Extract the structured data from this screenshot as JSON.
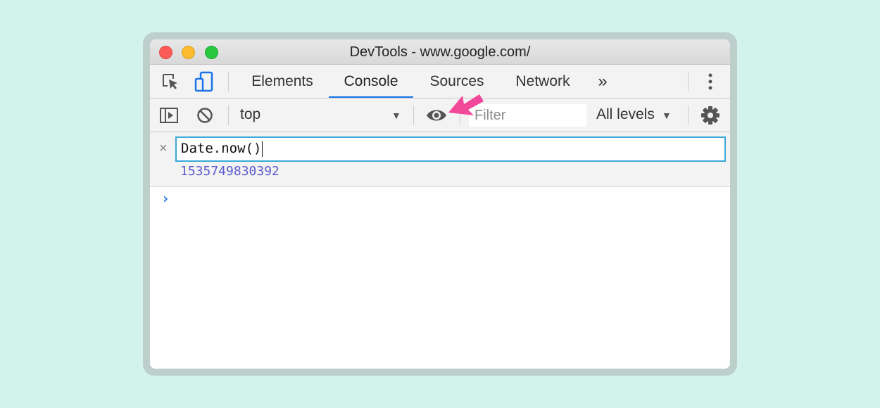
{
  "window": {
    "title": "DevTools - www.google.com/"
  },
  "tabs": [
    {
      "label": "Elements",
      "active": false
    },
    {
      "label": "Console",
      "active": true
    },
    {
      "label": "Sources",
      "active": false
    },
    {
      "label": "Network",
      "active": false
    }
  ],
  "tabbar": {
    "more_tabs_glyph": "»",
    "icons": [
      "inspect-element-icon",
      "device-toolbar-icon",
      "more-tabs-icon",
      "kebab-menu-icon"
    ]
  },
  "console_toolbar": {
    "context": "top",
    "filter_placeholder": "Filter",
    "filter_value": "",
    "levels": "All levels",
    "icons": [
      "show-sidebar-icon",
      "clear-console-icon",
      "live-expression-eye-icon",
      "settings-gear-icon"
    ]
  },
  "live_expression": {
    "remove_glyph": "×",
    "expression": "Date.now()",
    "result": "1535749830392"
  },
  "prompt": {
    "glyph": "›"
  },
  "colors": {
    "background": "#d2f3eb",
    "frame": "#bccfca",
    "tab_active_underline": "#1a73e8",
    "expression_border": "#3aa9d8",
    "result_text": "#5b5bcf",
    "annotation_arrow": "#f2489a"
  }
}
